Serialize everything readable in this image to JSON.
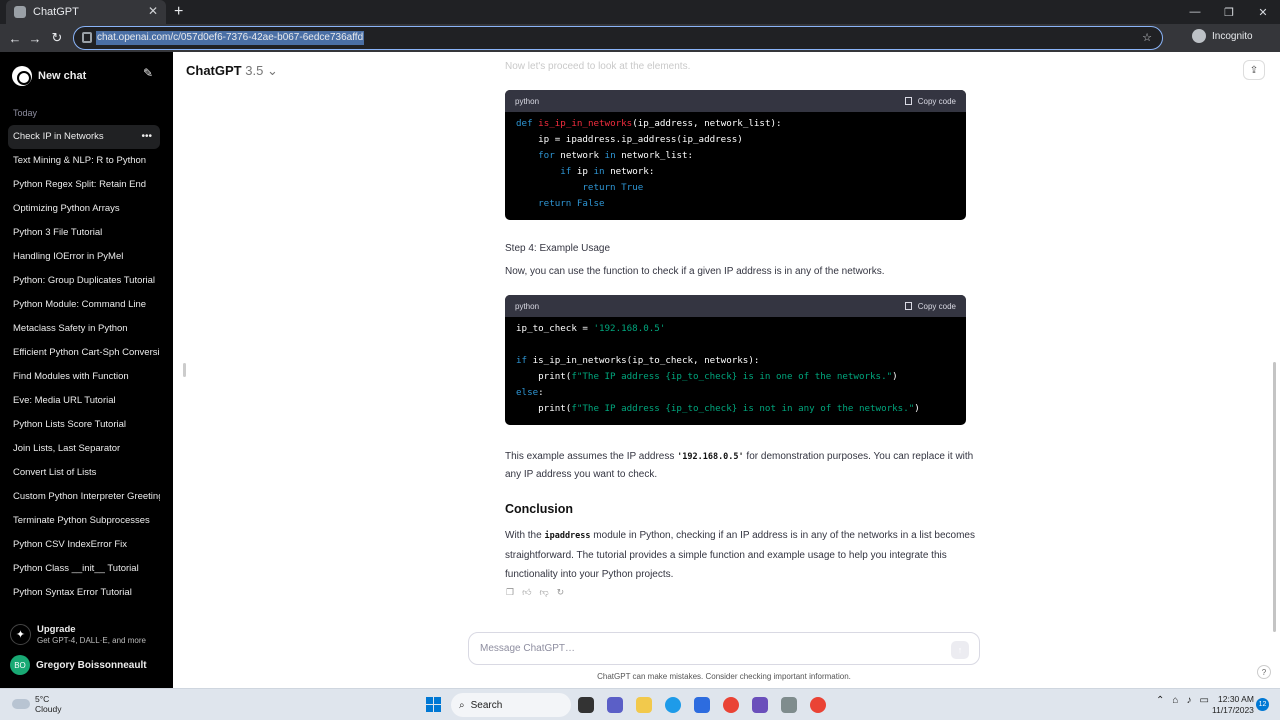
{
  "browser": {
    "tab_title": "ChatGPT",
    "url": "chat.openai.com/c/057d0ef6-7376-42ae-b067-6edce736affd",
    "incognito_label": "Incognito"
  },
  "sidebar": {
    "new_chat": "New chat",
    "section_today": "Today",
    "items": [
      {
        "label": "Check IP in Networks",
        "active": true
      },
      {
        "label": "Text Mining & NLP: R to Python"
      },
      {
        "label": "Python Regex Split: Retain End"
      },
      {
        "label": "Optimizing Python Arrays"
      },
      {
        "label": "Python 3 File Tutorial"
      },
      {
        "label": "Handling IOError in PyMel"
      },
      {
        "label": "Python: Group Duplicates Tutorial"
      },
      {
        "label": "Python Module: Command Line"
      },
      {
        "label": "Metaclass Safety in Python"
      },
      {
        "label": "Efficient Python Cart-Sph Conversion"
      },
      {
        "label": "Find Modules with Function"
      },
      {
        "label": "Eve: Media URL Tutorial"
      },
      {
        "label": "Python Lists Score Tutorial"
      },
      {
        "label": "Join Lists, Last Separator"
      },
      {
        "label": "Convert List of Lists"
      },
      {
        "label": "Custom Python Interpreter Greeting"
      },
      {
        "label": "Terminate Python Subprocesses"
      },
      {
        "label": "Python CSV IndexError Fix"
      },
      {
        "label": "Python Class __init__ Tutorial"
      },
      {
        "label": "Python Syntax Error Tutorial"
      }
    ],
    "upgrade_title": "Upgrade",
    "upgrade_sub": "Get GPT-4, DALL·E, and more",
    "user_initials": "BO",
    "user_name": "Gregory Boissonneault"
  },
  "header": {
    "model_name": "ChatGPT",
    "model_version": "3.5"
  },
  "content": {
    "faded_line": "Now let's proceed to look at the elements.",
    "code1": {
      "lang": "python",
      "copy_label": "Copy code"
    },
    "step4_title": "Step 4: Example Usage",
    "step4_text": "Now, you can use the function to check if a given IP address is in any of the networks.",
    "code2": {
      "lang": "python",
      "copy_label": "Copy code"
    },
    "example_pre": "This example assumes the IP address ",
    "example_code": "'192.168.0.5'",
    "example_post": " for demonstration purposes. You can replace it with any IP address you want to check.",
    "conclusion_title": "Conclusion",
    "conclusion_pre": "With the ",
    "conclusion_code": "ipaddress",
    "conclusion_post": " module in Python, checking if an IP address is in any of the networks in a list becomes straightforward. The tutorial provides a simple function and example usage to help you integrate this functionality into your Python projects."
  },
  "composer": {
    "placeholder": "Message ChatGPT…",
    "disclaimer": "ChatGPT can make mistakes. Consider checking important information."
  },
  "taskbar": {
    "temp": "5°C",
    "condition": "Cloudy",
    "search_label": "Search",
    "time": "12:30 AM",
    "date": "11/17/2023",
    "notif_count": "12"
  },
  "colors": {
    "accent": "#0078d4",
    "code_bg": "#000000",
    "keyword": "#2e95d3",
    "string": "#00a67d",
    "function": "#f22c3d"
  }
}
